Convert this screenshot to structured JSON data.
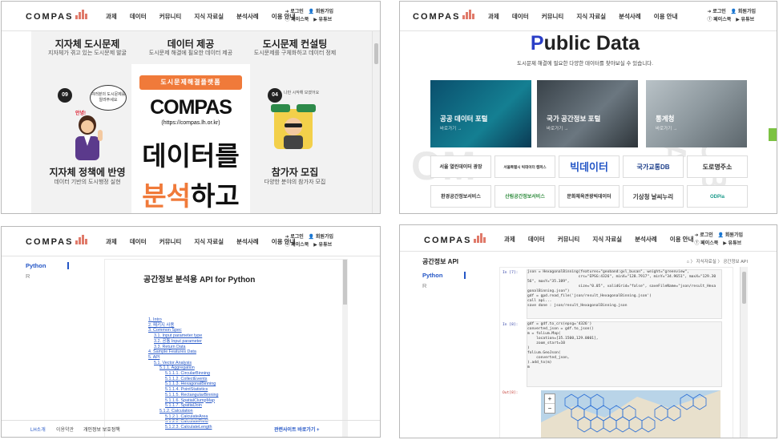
{
  "header": {
    "logo": "COMPAS",
    "nav": [
      "과제",
      "데이터",
      "커뮤니티",
      "지식 자료실",
      "분석사례",
      "이용 안내"
    ],
    "login": "로그인",
    "signup": "회원가입",
    "facebook": "페이스북",
    "youtube": "유튜브"
  },
  "panel1": {
    "col1_title": "지자체 도시문제",
    "col1_sub": "지자체가 겪고 있는 도시문제 발굴",
    "col2_title": "데이터 제공",
    "col2_sub": "도시문제 해결에 필요한 데이터 제공",
    "col3_title": "도시문제 컨설팅",
    "col3_sub": "도시문제를 구체화하고 데이터 정제",
    "badge_left": "09",
    "badge_right": "04",
    "bubble_left": "여러분의 도시문제를 알려주세요",
    "bubble_left_shout": "안녕!",
    "bubble_right": "나만 시작해 모였어요",
    "left_title": "지자체 정책에 반영",
    "left_sub": "데이터 기반의 도시행정 실현",
    "right_title": "참가자 모집",
    "right_sub": "다양한 분야의 참가자 모집",
    "poster_ribbon": "도시문제해결플랫폼",
    "poster_logo": "COMPAS",
    "poster_url": "(https://compas.lh.or.kr)",
    "poster_line1": "데이터를",
    "poster_line2_a": "분석",
    "poster_line2_b": "하고"
  },
  "panel2": {
    "title_p": "P",
    "title_rest": "ublic Data",
    "subtitle": "도시문제 해결에 필요한 다양한 데이터를 찾아보실 수 있습니다.",
    "cards": [
      {
        "title": "공공 데이터 포털",
        "more": "바로가기 →"
      },
      {
        "title": "국가 공간정보 포털",
        "more": "바로가기 →"
      },
      {
        "title": "통계청",
        "more": "바로가기 →"
      }
    ],
    "tiles_row1": [
      "서울 열린데이터 광장",
      "서울특별시 빅데이터 캠퍼스",
      "빅데이터",
      "국가교통DB",
      "도로명주소"
    ],
    "tiles_row2": [
      "환경공간정보서비스",
      "산림공간정보서비스",
      "문화체육관광빅데이터",
      "기상청 날씨누리",
      "ODPia"
    ],
    "watermark_left": "OM",
    "watermark_right": "PUB DA"
  },
  "panel3": {
    "side_python": "Python",
    "side_r": "R",
    "doc_title": "공간정보 분석용 API for Python",
    "toc": [
      "1. Intro",
      "2. 패키지 사용",
      "3. Common Spec",
      "3.1. Input parameter type",
      "3.2. 공통 Input parameter",
      "3.3. Return Data",
      "4. Sample Features Data",
      "5. API",
      "5.1. Vector Analysis",
      "5.1.1. Aggregation",
      "5.1.1.1. CircularBinning",
      "5.1.1.2. CollectEvents",
      "5.1.1.3. HexagonalBinning",
      "5.1.1.4. PointStatistics",
      "5.1.1.5. RectangularBinning",
      "5.1.1.6. SpatialClumpMap",
      "5.1.1.7. SpatialJoin",
      "5.1.2. Calculation",
      "5.1.2.1. CalculateArea",
      "5.1.2.2. CalculateField",
      "5.1.2.3. CalculateLength"
    ],
    "toc_levels": [
      0,
      0,
      0,
      1,
      1,
      1,
      0,
      0,
      1,
      2,
      3,
      3,
      3,
      3,
      3,
      3,
      3,
      2,
      3,
      3,
      3
    ],
    "footer_links": [
      "LH소개",
      "이용약관",
      "개인정보 보호정책"
    ],
    "footer_related": "관련사이트 바로가기 +"
  },
  "panel4": {
    "page_title": "공간정보 API",
    "breadcrumb": "⌂ 〉 지식자료실 〉 공간정보 API",
    "side_python": "Python",
    "side_r": "R",
    "prompt7": "In [7]:",
    "code7": [
      "json = HexagonalBinning(features=\"geoband:gvl_busan\", weight=\"greenview\",",
      "                       crs=\"EPSG:4326\", minX=\"128.7917\", minY=\"34.9651\", maxX=\"129.30",
      "56\", maxY=\"35.389\",",
      "                       size=\"0.05\", validGrid=\"false\", saveFileName=\"json/result_Hexa",
      "gonalBinning.json\")",
      "gdf = gpd.read_file('json/result_HexagonalBinning.json')",
      "",
      "call api...",
      "save done : json/result_HexagonalBinning.json"
    ],
    "prompt8": "In [8]:",
    "code8": [
      "gdf = gdf.to_crs(epsg='4326')",
      "converted_json = gdf.to_json()",
      "",
      "m = folium.Map(",
      "    location=[35.1500,129.0001],",
      "    zoom_start=10",
      ")",
      "",
      "folium.GeoJson(",
      "    converted_json,",
      ").add_to(m)",
      "",
      "m"
    ],
    "out8": "Out[8]:",
    "zoom_in": "+",
    "zoom_out": "−"
  }
}
